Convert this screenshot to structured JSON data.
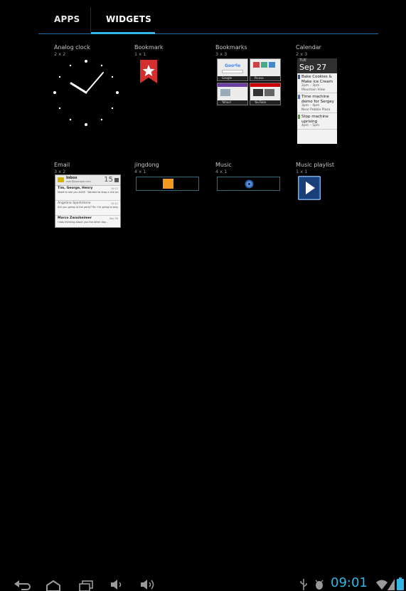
{
  "tabs": {
    "apps": "APPS",
    "widgets": "WIDGETS"
  },
  "widgets": [
    {
      "name": "Analog clock",
      "size": "2 x 2"
    },
    {
      "name": "Bookmark",
      "size": "1 x 1"
    },
    {
      "name": "Bookmarks",
      "size": "3 x 3"
    },
    {
      "name": "Calendar",
      "size": "2 x 3"
    },
    {
      "name": "Email",
      "size": "3 x 2"
    },
    {
      "name": "jingdong",
      "size": "4 x 1"
    },
    {
      "name": "Music",
      "size": "4 x 1"
    },
    {
      "name": "Music playlist",
      "size": "1 x 1"
    }
  ],
  "bookmarks_preview": [
    "Google",
    "Picasa",
    "Yahoo!",
    "YouTube"
  ],
  "calendar": {
    "dow": "TUE",
    "date": "Sep 27",
    "events": [
      {
        "title": "Bake Cookies & Make ice Cream",
        "time": "2pm – 3pm",
        "place": "Mountain View"
      },
      {
        "title": "Time machine demo for Sergey",
        "time": "3pm – 4pm",
        "place": "Near Pebble Plaza"
      },
      {
        "title": "Stop machine uprising",
        "time": "4pm – 5pm",
        "place": ""
      }
    ]
  },
  "email": {
    "folder": "Inbox",
    "account": "user@example.com",
    "count": "15",
    "messages": [
      {
        "from": "Tim, George, Henry",
        "time": "10:12",
        "snippet": "Need to see you ASAP · Wanted to drop a line and tell you how nice it was to see you."
      },
      {
        "from": "Angelina Sparkstone",
        "time": "10:12",
        "snippet": "Are you going to the party? Re: I'm going to play the guitar and sing."
      },
      {
        "from": "Marco Zwasheimer",
        "time": "Sep 30",
        "snippet": "I was thinking about you the other day..."
      }
    ]
  },
  "status": {
    "time": "09:01"
  },
  "colors": {
    "accent": "#33b5e5",
    "bookmark_red": "#d32f2f",
    "calendar_bar1": "#3b5998",
    "calendar_bar2": "#4a7cc9",
    "calendar_bar3": "#5a9a3a"
  }
}
